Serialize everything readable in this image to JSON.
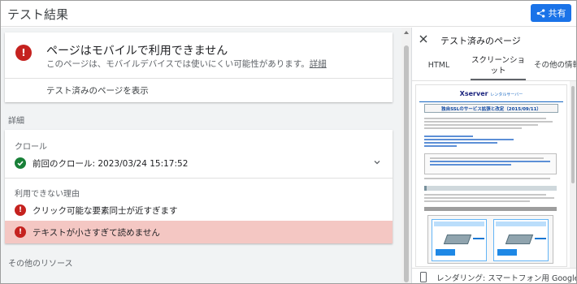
{
  "header": {
    "title": "テスト結果",
    "share_label": "共有"
  },
  "result_card": {
    "headline": "ページはモバイルで利用できません",
    "description": "このページは、モバイルデバイスでは使いにくい可能性があります。",
    "details_link": "詳細",
    "view_tested_page": "テスト済みのページを表示"
  },
  "details": {
    "section_label": "詳細",
    "crawl_label": "クロール",
    "last_crawl": "前回のクロール: 2023/03/24 15:17:52",
    "reasons_label": "利用できない理由",
    "issues": [
      {
        "text": "クリック可能な要素同士が近すぎます"
      },
      {
        "text": "テキストが小さすぎて読めません"
      }
    ]
  },
  "other_resources": {
    "section_label": "その他のリソース"
  },
  "side_panel": {
    "title": "テスト済みのページ",
    "tabs": [
      {
        "label": "HTML"
      },
      {
        "label": "スクリーンショット"
      },
      {
        "label": "その他の情報"
      }
    ],
    "active_tab": 1,
    "screenshot": {
      "logo": "Xserver",
      "logo_sub": "レンタルサーバー",
      "heading": "独自SSLのサービス拡張と改定（2015/09/11）"
    },
    "footer": "レンダリング: スマートフォン用 Googlebot"
  },
  "colors": {
    "accent": "#1a73e8",
    "error": "#c5221f",
    "success": "#188038",
    "issue_highlight": "#f4c7c3"
  }
}
